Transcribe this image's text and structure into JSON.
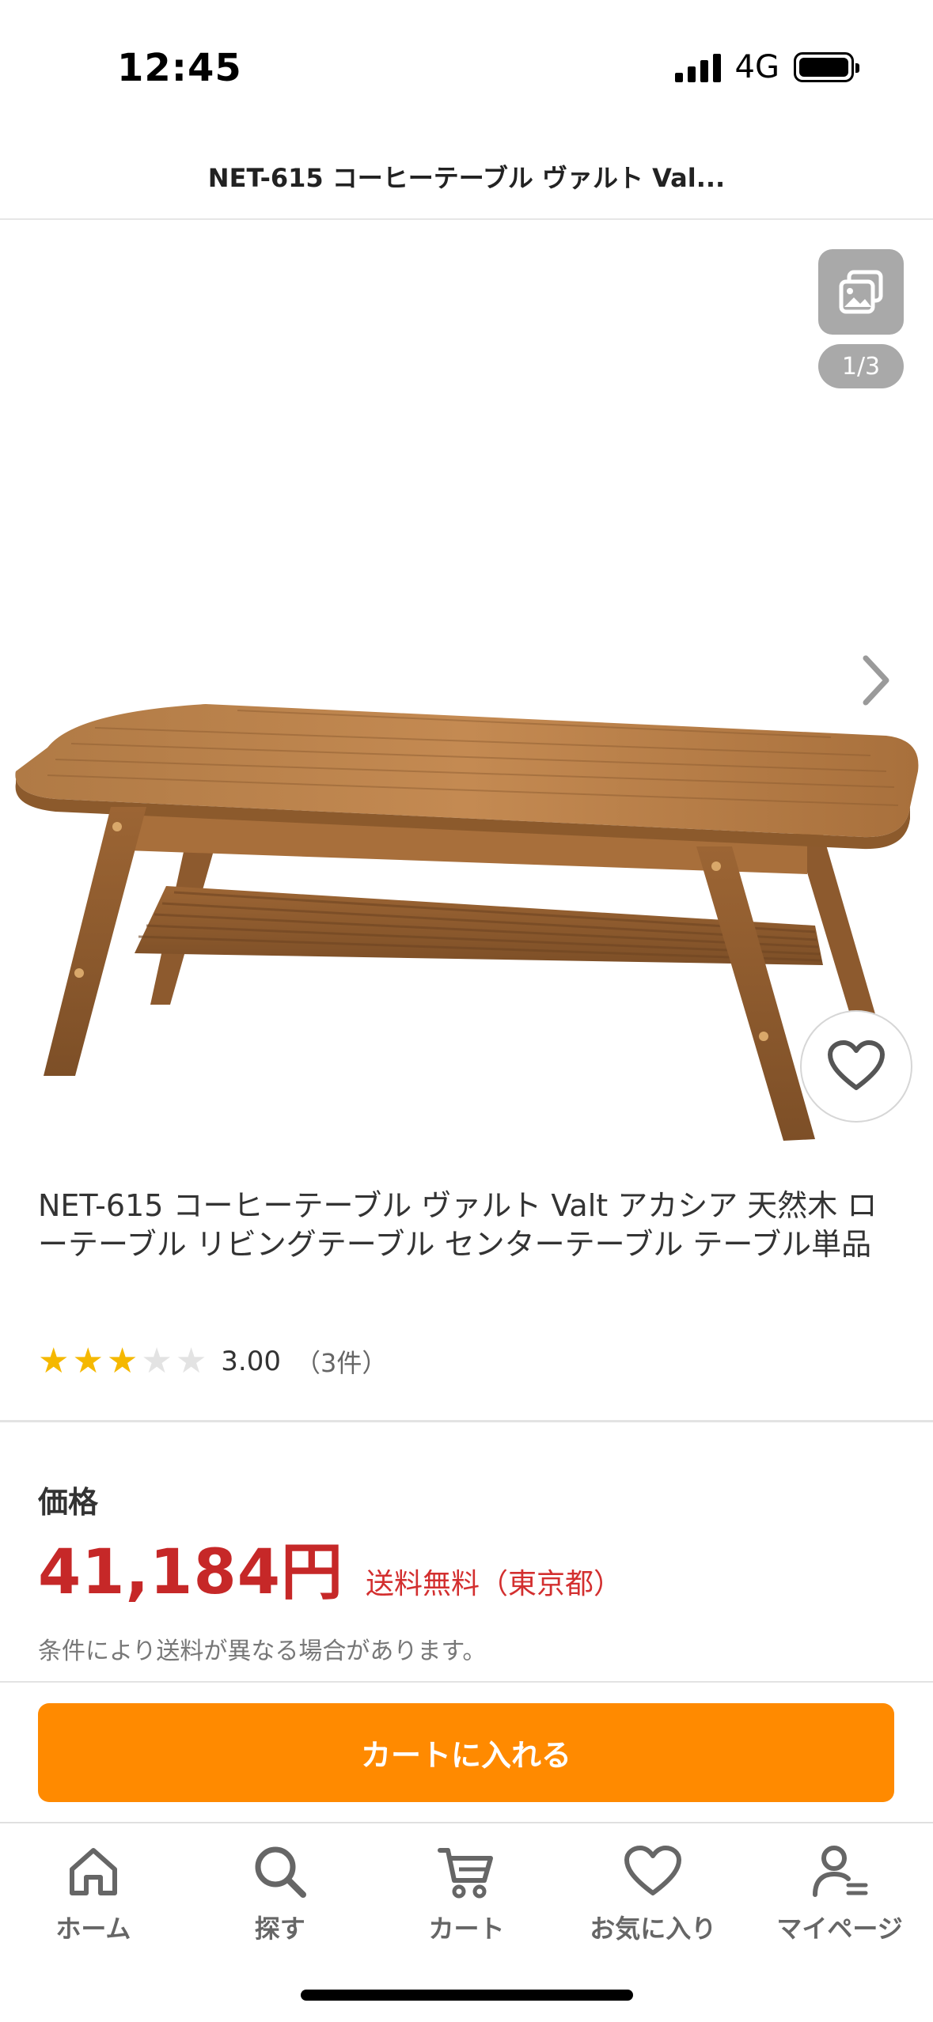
{
  "status_bar": {
    "time": "12:45",
    "network": "4G"
  },
  "header": {
    "title": "NET-615 コーヒーテーブル ヴァルト Val..."
  },
  "gallery": {
    "counter": "1/3"
  },
  "product": {
    "name": "NET-615 コーヒーテーブル ヴァルト Valt アカシア 天然木 ローテーブル リビングテーブル センターテーブル テーブル単品",
    "rating": {
      "value": 3,
      "max": 5,
      "score": "3.00",
      "count": "（3件）"
    }
  },
  "price": {
    "label": "価格",
    "value": "41,184円",
    "shipping": "送料無料（東京都）",
    "note": "条件により送料が異なる場合があります。"
  },
  "cart_button": {
    "label": "カートに入れる"
  },
  "tabs": [
    {
      "label": "ホーム",
      "icon": "home-icon"
    },
    {
      "label": "探す",
      "icon": "search-icon"
    },
    {
      "label": "カート",
      "icon": "cart-icon"
    },
    {
      "label": "お気に入り",
      "icon": "heart-icon"
    },
    {
      "label": "マイページ",
      "icon": "user-icon"
    }
  ],
  "colors": {
    "accent": "#ff8a00",
    "price": "#c62828",
    "star": "#f5b800"
  }
}
